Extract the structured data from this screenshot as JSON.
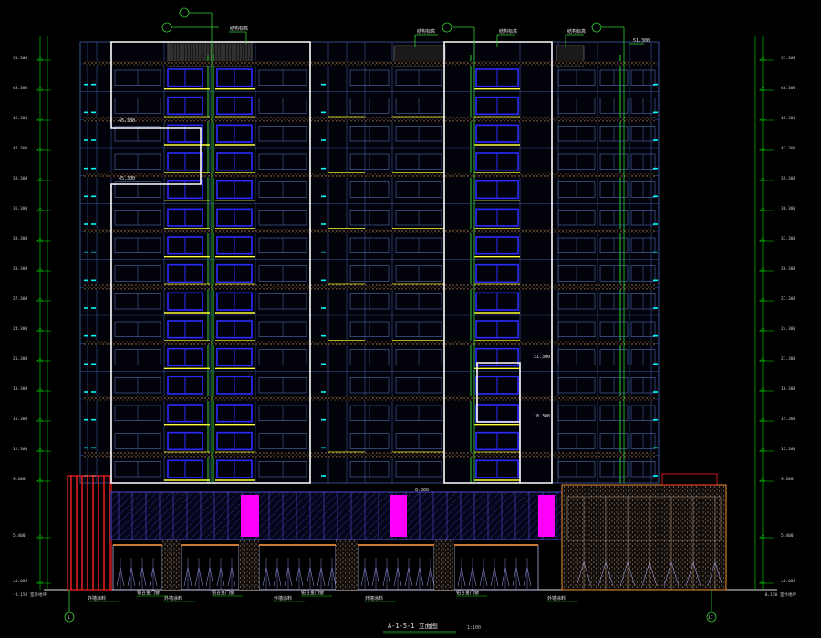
{
  "drawing": {
    "title": "A-1-5-1 立面图",
    "scale": "1:100",
    "grid_left": "1",
    "grid_right": "17"
  },
  "callouts": {
    "top": [
      "结构标高",
      "结构标高",
      "结构标高",
      "结构标高"
    ],
    "top_right": "51.300"
  },
  "levels": {
    "left": [
      "51.300",
      "48.300",
      "45.300",
      "42.300",
      "39.300",
      "36.300",
      "33.300",
      "30.300",
      "27.300",
      "24.300",
      "21.300",
      "18.300",
      "15.300",
      "12.300",
      "9.300",
      "5.400",
      "±0.000"
    ],
    "right": [
      "51.300",
      "48.300",
      "45.300",
      "42.300",
      "39.300",
      "36.300",
      "33.300",
      "30.300",
      "27.300",
      "24.300",
      "21.300",
      "18.300",
      "15.300",
      "12.300",
      "9.300",
      "5.400",
      "±0.000"
    ],
    "bottom_left": "-0.150 室外地坪",
    "bottom_right": "-0.150 室外地坪"
  },
  "inline_marks": [
    "45.300",
    "45.300",
    "21.300",
    "18.300",
    "6.300"
  ],
  "podium_notes": [
    "外墙涂料",
    "铝合金门窗",
    "外墙涂料",
    "铝合金门窗",
    "外墙涂料",
    "铝合金门窗",
    "外墙涂料",
    "铝合金门窗",
    "外墙涂料"
  ],
  "colors": {
    "bg": "#000000",
    "outline": "#ffffff",
    "window": "#2a2aff",
    "cyan": "#00ffff",
    "yellow": "#ffff33",
    "green": "#33cc33",
    "magenta": "#ff00ff",
    "red": "#ff2020",
    "brown": "#c87830",
    "dim": "#00dd00"
  }
}
